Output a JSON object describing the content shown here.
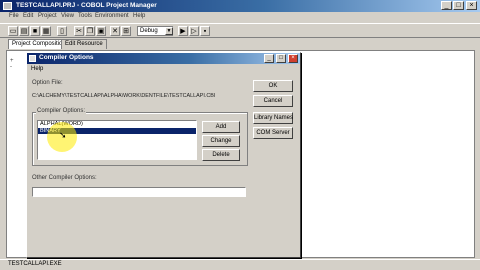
{
  "app": {
    "title": "TESTCALLAPI.PRJ - COBOL Project Manager",
    "minimize_icon": "minimize-icon",
    "maximize_icon": "maximize-icon",
    "close_icon": "close-icon"
  },
  "menu": [
    "File",
    "Edit",
    "Project",
    "View",
    "Tools",
    "Environment",
    "Help"
  ],
  "toolbar": {
    "configuration": "Debug"
  },
  "tabs": [
    {
      "label": "Project Composition",
      "active": true
    },
    {
      "label": "Edit Resource",
      "active": false
    }
  ],
  "tree": {
    "lines": [
      "+",
      "-"
    ]
  },
  "status": {
    "text": "TESTCALLAPI.EXE"
  },
  "dialog": {
    "title": "Compiler Options",
    "menu_label": "Help",
    "option_file_label": "Option File:",
    "option_file_path": "C:\\ALCHEMY\\TESTCALLAPI\\ALPHA\\WORK\\DENTFILE\\TESTCALLAPI.CBI",
    "compiler_options_label": "Compiler Options:",
    "options": [
      {
        "label": "ALPHAL(WORD)",
        "selected": false
      },
      {
        "label": "BINARY",
        "selected": true
      }
    ],
    "buttons": {
      "ok": "OK",
      "cancel": "Cancel",
      "library_names": "Library Names",
      "com_server": "COM Server",
      "add": "Add",
      "change": "Change",
      "delete": "Delete"
    },
    "other_label": "Other Compiler Options:",
    "other_value": ""
  }
}
